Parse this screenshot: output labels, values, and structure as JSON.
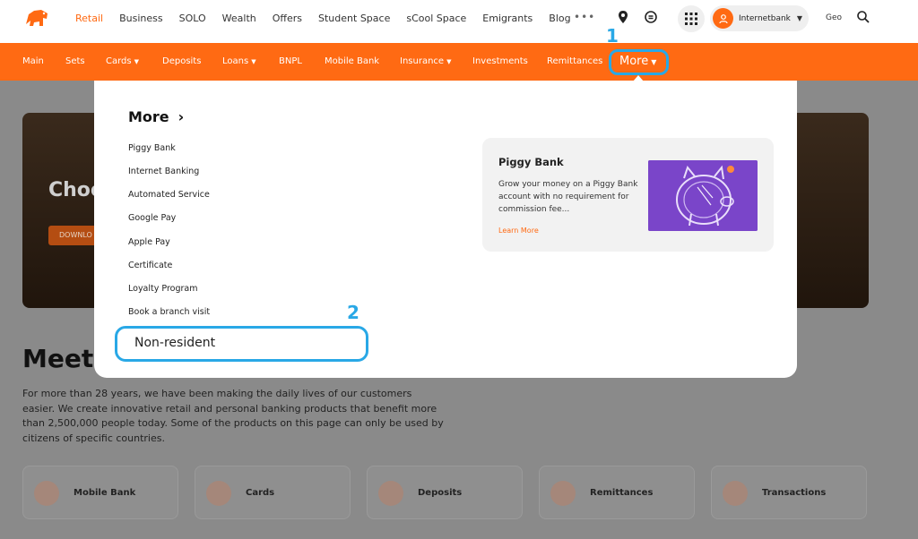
{
  "top_nav": {
    "items": [
      "Retail",
      "Business",
      "SOLO",
      "Wealth",
      "Offers",
      "Student Space",
      "sCool Space",
      "Emigrants",
      "Blog"
    ],
    "more_dots": "•••",
    "internetbank_label": "Internetbank",
    "lang": "Geo"
  },
  "main_nav": {
    "items": [
      "Main",
      "Sets",
      "Cards",
      "Deposits",
      "Loans",
      "BNPL",
      "Mobile Bank",
      "Insurance",
      "Investments",
      "Remittances"
    ],
    "more_label": "More"
  },
  "annotations": {
    "marker_1": "1",
    "marker_2": "2"
  },
  "dropdown": {
    "title": "More",
    "links": [
      "Piggy Bank",
      "Internet Banking",
      "Automated Service",
      "Google Pay",
      "Apple Pay",
      "Certificate",
      "Loyalty Program",
      "Book a branch visit"
    ],
    "highlighted_link": "Non-resident",
    "promo": {
      "title": "Piggy Bank",
      "description": "Grow your money on a Piggy Bank account with no requirement for commission fee...",
      "link": "Learn More"
    }
  },
  "hero": {
    "title": "Choo",
    "button": "DOWNLO"
  },
  "page": {
    "heading": "Meet",
    "intro": "For more than 28 years, we have been making the daily lives of our customers easier. We create innovative retail and personal banking products that benefit more than 2,500,000 people today. Some of the products on this page can only be used by citizens of specific countries."
  },
  "quick_cards": [
    "Mobile Bank",
    "Cards",
    "Deposits",
    "Remittances",
    "Transactions"
  ],
  "colors": {
    "brand": "#ff6a13",
    "annotation": "#29a8e6",
    "promo_image": "#7a45c9"
  }
}
